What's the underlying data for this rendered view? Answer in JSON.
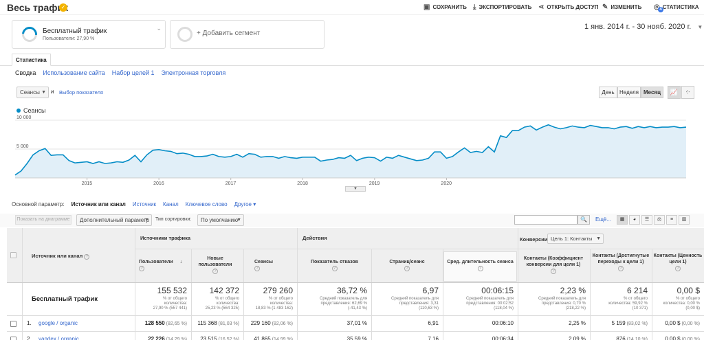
{
  "header": {
    "title": "Весь трафик",
    "actions": [
      {
        "label": "СОХРАНИТЬ",
        "icon": "save-icon"
      },
      {
        "label": "ЭКСПОРТИРОВАТЬ",
        "icon": "export-icon"
      },
      {
        "label": "ОТКРЫТЬ ДОСТУП",
        "icon": "share-icon"
      },
      {
        "label": "ИЗМЕНИТЬ",
        "icon": "pencil-icon"
      },
      {
        "label": "СТАТИСТИКА",
        "icon": "insights-icon",
        "badge": "4"
      }
    ]
  },
  "segments": {
    "active": {
      "name": "Бесплатный трафик",
      "sub": "Пользователи: 27,90 %"
    },
    "add_label": "+ Добавить сегмент"
  },
  "date_range": "1 янв. 2014 г. - 30 нояб. 2020 г.",
  "tabs": {
    "active": "Статистика"
  },
  "subnav": [
    "Сводка",
    "Использование сайта",
    "Набор целей 1",
    "Электронная торговля"
  ],
  "chart_controls": {
    "metric": "Сеансы",
    "and": "и",
    "pick_metric": "Выбор показателя",
    "periods": [
      "День",
      "Неделя",
      "Месяц"
    ],
    "active_period": "Месяц"
  },
  "chart_data": {
    "type": "area",
    "series": [
      {
        "name": "Сеансы",
        "color": "#058dc7"
      }
    ],
    "yticks": [
      "10 000",
      "5 000"
    ],
    "xticks": [
      "2015",
      "2016",
      "2017",
      "2018",
      "2019",
      "2020"
    ],
    "values": [
      500,
      1200,
      2500,
      4000,
      4700,
      5100,
      3900,
      4000,
      4000,
      3000,
      2600,
      2700,
      2800,
      2500,
      2800,
      2500,
      2600,
      2800,
      2700,
      3100,
      3900,
      2800,
      4000,
      4800,
      4900,
      4700,
      4600,
      4200,
      4300,
      4100,
      3700,
      3700,
      3800,
      4100,
      3700,
      3600,
      3700,
      4100,
      3600,
      4200,
      4100,
      3600,
      3700,
      3700,
      3400,
      3700,
      3500,
      3400,
      3600,
      3600,
      3600,
      2900,
      3100,
      3200,
      3500,
      3400,
      3900,
      3000,
      3400,
      3600,
      3500,
      2900,
      3600,
      3400,
      3900,
      3600,
      3300,
      3000,
      3100,
      3400,
      4500,
      4500,
      3400,
      3700,
      4500,
      5200,
      4400,
      4600,
      4400,
      5400,
      4500,
      7300,
      7000,
      8200,
      8200,
      8800,
      9000,
      8300,
      8800,
      9200,
      8800,
      8500,
      8700,
      9000,
      8800,
      8700,
      9100,
      8900,
      8700,
      8700,
      8500,
      8800,
      8900,
      8600,
      8900,
      8700,
      8900,
      8700,
      8800,
      8800,
      8900,
      8700,
      8800
    ]
  },
  "dimensions": {
    "label": "Основной параметр:",
    "current": "Источник или канал",
    "options": [
      "Источник",
      "Канал",
      "Ключевое слово",
      "Другое"
    ]
  },
  "table_tools": {
    "show_chart": "Показать на диаграмме",
    "secondary": "Дополнительный параметр",
    "sort_label": "Тип сортировки:",
    "sort_value": "По умолчанию",
    "more": "Ещё..."
  },
  "table": {
    "dim_header": "Источник или канал",
    "groups": {
      "acq": "Источники трафика",
      "beh": "Действия",
      "conv": "Конверсии",
      "goal_select": "Цель 1: Контакты"
    },
    "columns": [
      "Пользователи",
      "Новые пользователи",
      "Сеансы",
      "Показатель отказов",
      "Страниц/сеанс",
      "Сред. длительность сеанса",
      "Контакты (Коэффициент конверсии для цели 1)",
      "Контакты (Достигнутые переходы к цели 1)",
      "Контакты (Ценность цели 1)"
    ],
    "totals": {
      "label": "Бесплатный трафик",
      "values": [
        "155 532",
        "142 372",
        "279 260",
        "36,72 %",
        "6,97",
        "00:06:15",
        "2,23 %",
        "6 214",
        "0,00 $"
      ],
      "subs": [
        [
          "% от общего",
          "количества:",
          "27,90 % (557 441)"
        ],
        [
          "% от общего",
          "количества:",
          "25,23 % (564 325)"
        ],
        [
          "% от общего",
          "количества:",
          "18,83 % (1 483 162)"
        ],
        [
          "Средний показатель для",
          "представления: 62,69 %",
          "(-41,43 %)"
        ],
        [
          "Средний показатель для",
          "представления: 3,31",
          "(110,63 %)"
        ],
        [
          "Средний показатель для",
          "представления: 00:02:52",
          "(118,04 %)"
        ],
        [
          "Средний показатель для",
          "представления: 0,70 %",
          "(218,22 %)"
        ],
        [
          "% от общего",
          "количества: 59,92 %",
          "(10 371)"
        ],
        [
          "% от общего",
          "количества: 0,00 %",
          "(0,00 $)"
        ]
      ]
    },
    "rows": [
      {
        "index": "1.",
        "source": "google / organic",
        "cells": [
          {
            "v": "128 550",
            "p": "(82,65 %)"
          },
          {
            "v": "115 368",
            "p": "(81,03 %)"
          },
          {
            "v": "229 160",
            "p": "(82,06 %)"
          },
          {
            "v": "37,01 %",
            "p": ""
          },
          {
            "v": "6,91",
            "p": ""
          },
          {
            "v": "00:06:10",
            "p": ""
          },
          {
            "v": "2,25 %",
            "p": ""
          },
          {
            "v": "5 159",
            "p": "(83,02 %)"
          },
          {
            "v": "0,00 $",
            "p": "(0,00 %)"
          }
        ]
      },
      {
        "index": "2.",
        "source": "yandex / organic",
        "cells": [
          {
            "v": "22 226",
            "p": "(14,29 %)"
          },
          {
            "v": "23 515",
            "p": "(16,52 %)"
          },
          {
            "v": "41 865",
            "p": "(14,99 %)"
          },
          {
            "v": "35,59 %",
            "p": ""
          },
          {
            "v": "7,16",
            "p": ""
          },
          {
            "v": "00:06:34",
            "p": ""
          },
          {
            "v": "2,09 %",
            "p": ""
          },
          {
            "v": "876",
            "p": "(14,10 %)"
          },
          {
            "v": "0,00 $",
            "p": "(0,00 %)"
          }
        ]
      }
    ]
  }
}
